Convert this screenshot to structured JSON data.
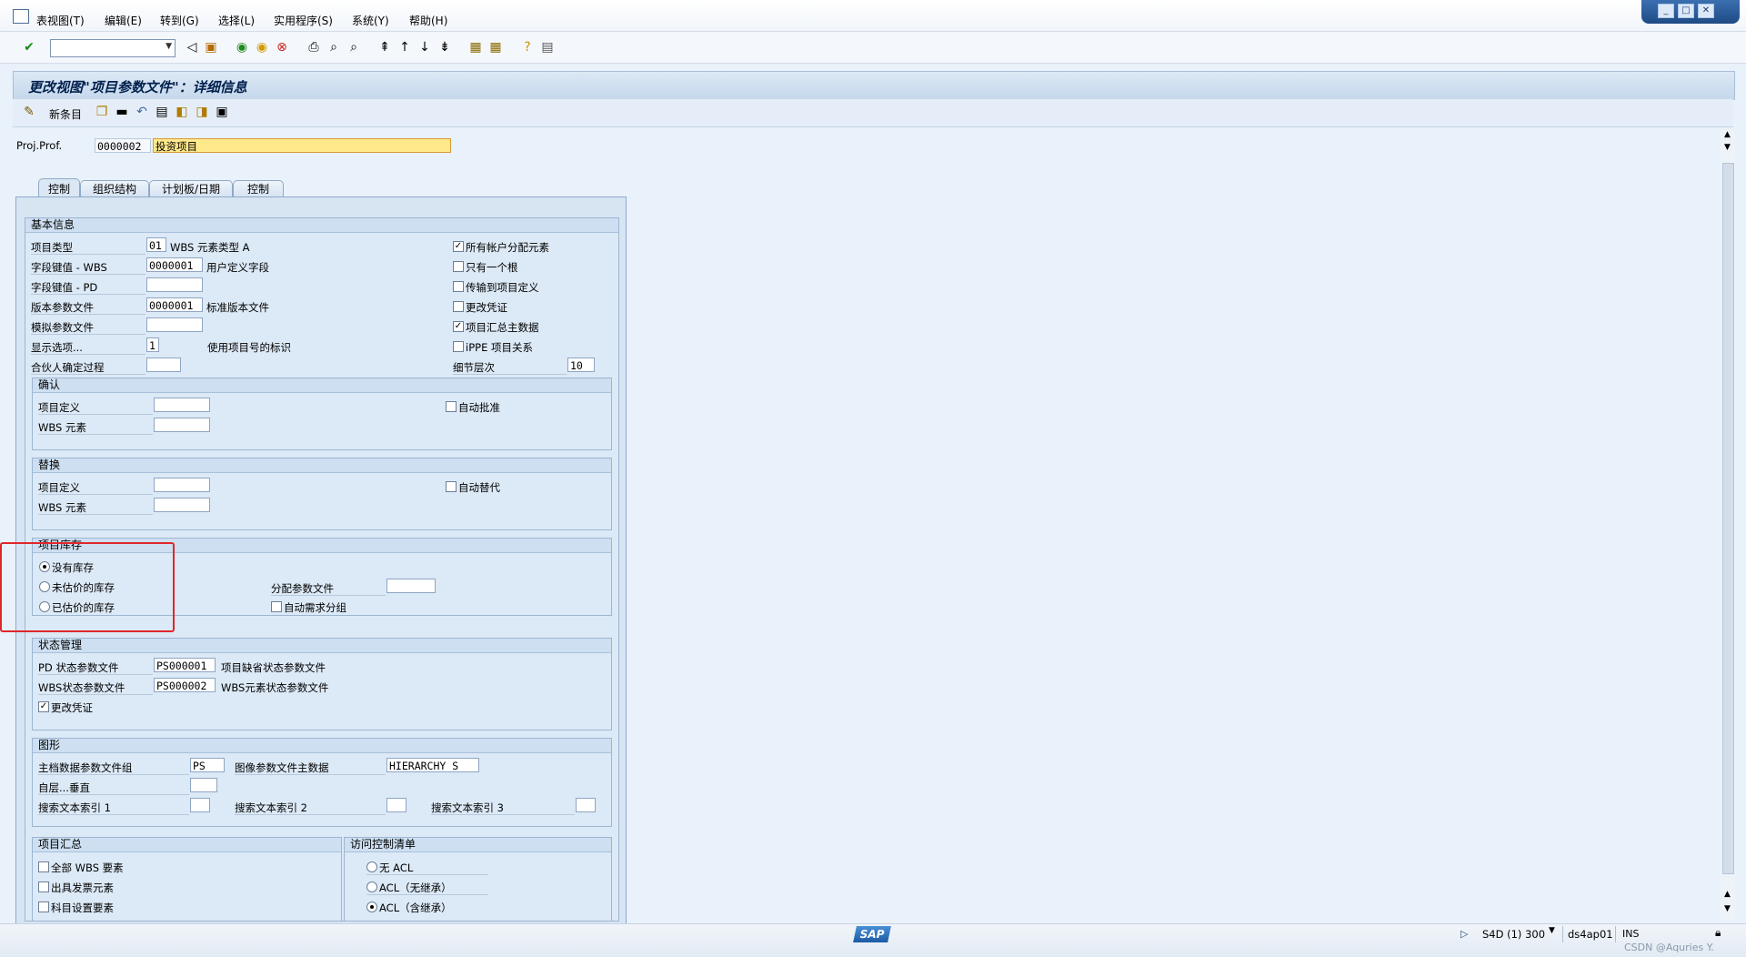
{
  "menu": [
    "表视图(T)",
    "编辑(E)",
    "转到(G)",
    "选择(L)",
    "实用程序(S)",
    "系统(Y)",
    "帮助(H)"
  ],
  "window": {
    "minimize": "_",
    "restore": "□",
    "close": "✕"
  },
  "toolbar": {
    "command_value": ""
  },
  "title": "更改视图\"项目参数文件\"：详细信息",
  "apptoolbar": {
    "new_entries": "新条目"
  },
  "header": {
    "label": "Proj.Prof.",
    "code": "0000002",
    "desc": "投资项目"
  },
  "tabs": [
    "控制",
    "组织结构",
    "计划板/日期",
    "控制"
  ],
  "basic": {
    "title": "基本信息",
    "project_type_label": "项目类型",
    "project_type": "01",
    "project_type_desc": "WBS 元素类型 A",
    "field_key_wbs_label": "字段键值 - WBS",
    "field_key_wbs": "0000001",
    "field_key_wbs_desc": "用户定义字段",
    "field_key_pd_label": "字段键值 - PD",
    "field_key_pd": "",
    "version_profile_label": "版本参数文件",
    "version_profile": "0000001",
    "version_profile_desc": "标准版本文件",
    "sim_profile_label": "模拟参数文件",
    "sim_profile": "",
    "display_option_label": "显示选项...",
    "display_option": "1",
    "display_option_desc": "使用项目号的标识",
    "partner_label": "合伙人确定过程",
    "partner": "",
    "all_acct_label": "所有帐户分配元素",
    "all_acct": true,
    "one_root_label": "只有一个根",
    "one_root": false,
    "transfer_label": "传输到项目定义",
    "transfer": false,
    "change_doc_label": "更改凭证",
    "change_doc": false,
    "summary_master_label": "项目汇总主数据",
    "summary_master": true,
    "ippe_label": "iPPE 项目关系",
    "ippe": false,
    "detail_level_label": "细节层次",
    "detail_level": "10"
  },
  "confirm": {
    "title": "确认",
    "proj_def_label": "项目定义",
    "proj_def": "",
    "wbs_label": "WBS 元素",
    "wbs": "",
    "auto_approve_label": "自动批准",
    "auto_approve": false
  },
  "subst": {
    "title": "替换",
    "proj_def_label": "项目定义",
    "proj_def": "",
    "wbs_label": "WBS 元素",
    "wbs": "",
    "auto_subst_label": "自动替代",
    "auto_subst": false
  },
  "stock": {
    "title": "项目库存",
    "none_label": "没有库存",
    "nonval_label": "未估价的库存",
    "val_label": "已估价的库存",
    "selected": "none",
    "alloc_label": "分配参数文件",
    "alloc": "",
    "auto_req_label": "自动需求分组",
    "auto_req": false
  },
  "status": {
    "title": "状态管理",
    "pd_label": "PD 状态参数文件",
    "pd": "PS000001",
    "pd_desc": "项目缺省状态参数文件",
    "wbs_label": "WBS状态参数文件",
    "wbs": "PS000002",
    "wbs_desc": "WBS元素状态参数文件",
    "change_doc_label": "更改凭证",
    "change_doc": true
  },
  "graphics": {
    "title": "图形",
    "master_group_label": "主档数据参数文件组",
    "master_group": "PS",
    "graphic_master_label": "图像参数文件主数据",
    "graphic_master": "HIERARCHY_S",
    "vertical_label": "自层...垂直",
    "vertical": "",
    "search1_label": "搜索文本索引 1",
    "search1": "",
    "search2_label": "搜索文本索引 2",
    "search2": "",
    "search3_label": "搜索文本索引 3",
    "search3": ""
  },
  "summary": {
    "title": "项目汇总",
    "all_wbs_label": "全部 WBS 要素",
    "all_wbs": false,
    "billing_label": "出具发票元素",
    "billing": false,
    "acct_label": "科目设置要素",
    "acct": false
  },
  "acl": {
    "title": "访问控制清单",
    "none_label": "无 ACL",
    "noinherit_label": "ACL（无继承）",
    "inherit_label": "ACL（含继承）",
    "selected": "inherit"
  },
  "statusbar": {
    "logo": "SAP",
    "system": "S4D (1) 300",
    "server": "ds4ap01",
    "mode": "INS",
    "watermark": "CSDN @Aquries Y."
  }
}
